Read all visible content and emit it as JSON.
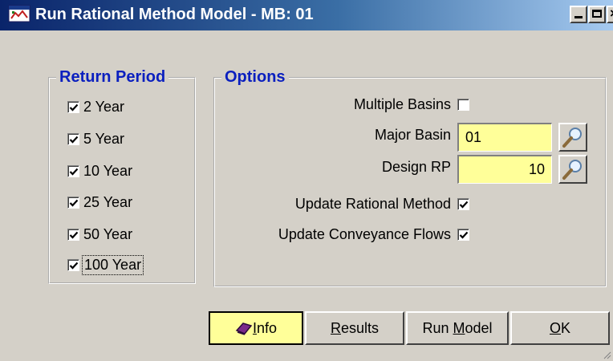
{
  "window": {
    "title": "Run Rational Method Model - MB: 01",
    "controls": [
      "minimize-icon",
      "maximize-icon",
      "close-icon"
    ]
  },
  "return_period": {
    "title": "Return Period",
    "items": [
      {
        "label": "2 Year",
        "checked": true
      },
      {
        "label": "5 Year",
        "checked": true
      },
      {
        "label": "10 Year",
        "checked": true
      },
      {
        "label": "25 Year",
        "checked": true
      },
      {
        "label": "50 Year",
        "checked": true
      },
      {
        "label": "100 Year",
        "checked": true,
        "focused": true
      }
    ]
  },
  "options": {
    "title": "Options",
    "multiple_basins_label": "Multiple Basins",
    "multiple_basins_checked": false,
    "major_basin_label": "Major Basin",
    "major_basin_value": "01",
    "design_rp_label": "Design RP",
    "design_rp_value": "10",
    "update_rational_label": "Update Rational Method",
    "update_rational_checked": true,
    "update_conveyance_label": "Update Conveyance Flows",
    "update_conveyance_checked": true
  },
  "buttons": {
    "info_label": "Info",
    "results_label": "Results",
    "run_prefix": "Run ",
    "run_accel": "M",
    "run_suffix": "odel",
    "ok_label": "OK"
  },
  "colors": {
    "title_bar": "#0a246a",
    "group_title": "#0a1fbf",
    "field_bg": "#ffff99",
    "face": "#d4d0c8"
  }
}
